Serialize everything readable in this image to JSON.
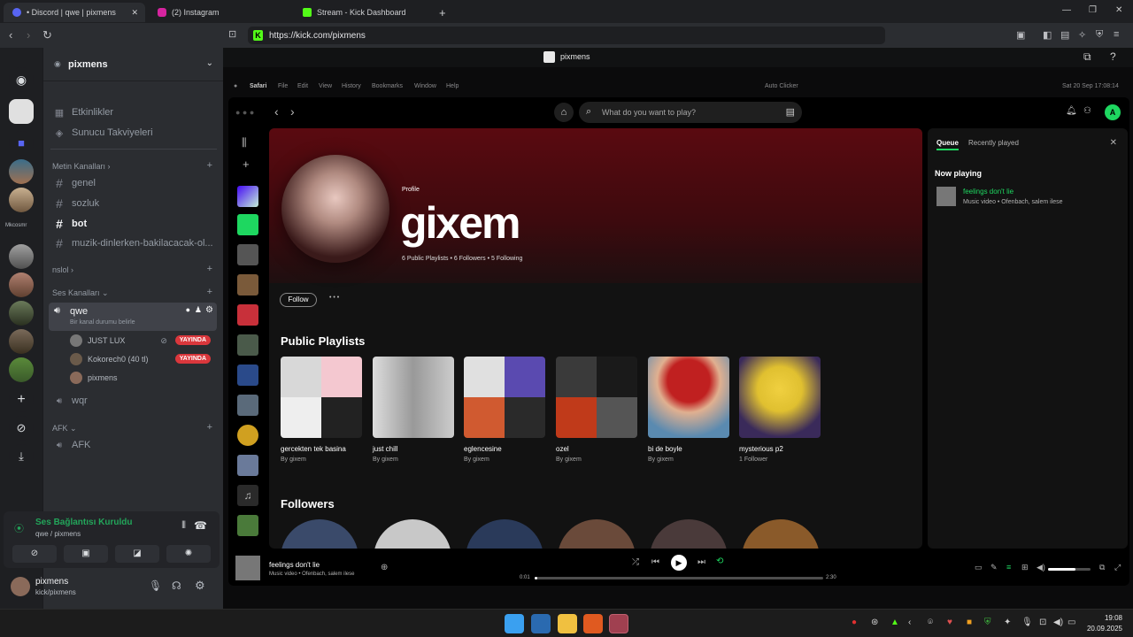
{
  "browser": {
    "tabs": [
      {
        "label": "• Discord | qwe | pixmens",
        "active": true
      },
      {
        "label": "(2) Instagram",
        "active": false
      },
      {
        "label": "Stream - Kick Dashboard",
        "active": false
      }
    ],
    "url": "https://kick.com/pixmens",
    "new_tab": "+",
    "win_min": "—",
    "win_max": "❐",
    "win_close": "✕"
  },
  "discord": {
    "server_name": "pixmens",
    "top_items": [
      "Etkinlikler",
      "Sunucu Takviyeleri"
    ],
    "text_category": "Metin Kanalları",
    "text_channels": [
      "genel",
      "sozluk",
      "bot",
      "muzik-dinlerken-bakilacacak-ol..."
    ],
    "nslol": "nslol",
    "voice_category": "Ses Kanalları",
    "active_voice": "qwe",
    "active_voice_status": "Bir kanal durumu belirle",
    "members": [
      {
        "name": "JUST LUX",
        "live": true
      },
      {
        "name": "Kokorech0 (40 tl)",
        "live": true
      },
      {
        "name": "pixmens",
        "live": false
      }
    ],
    "live_label": "YAYINDA",
    "other_voice": "wqr",
    "afk_category": "AFK",
    "afk_channel": "AFK",
    "server_label_text": "Mkcosmr",
    "voice_status": "Ses Bağlantısı Kuruldu",
    "voice_sub": "qwe / pixmens",
    "user_name": "pixmens",
    "user_sub": "kick/pixmens"
  },
  "kick": {
    "channel_name": "pixmens"
  },
  "mac_menu": [
    "Safari",
    "File",
    "Edit",
    "View",
    "History",
    "Bookmarks",
    "Window",
    "Help"
  ],
  "mac_tray": [
    "Auto Clicker",
    "Sat 20 Sep 17:08:14"
  ],
  "spotify": {
    "search_placeholder": "What do you want to play?",
    "profile_label": "Profile",
    "profile_name": "gixem",
    "profile_stats": "6 Public Playlists • 6 Followers • 5 Following",
    "follow_label": "Follow",
    "more_label": "• • •",
    "public_playlists_title": "Public Playlists",
    "playlists": [
      {
        "name": "gercekten tek basina",
        "by": "By gixem"
      },
      {
        "name": "just chill",
        "by": "By gixem"
      },
      {
        "name": "eglencesine",
        "by": "By gixem"
      },
      {
        "name": "ozel",
        "by": "By gixem"
      },
      {
        "name": "bi de boyle",
        "by": "By gixem"
      },
      {
        "name": "mysterious p2",
        "by": "1 Follower"
      }
    ],
    "followers_title": "Followers",
    "queue_tab": "Queue",
    "recent_tab": "Recently played",
    "now_playing_label": "Now playing",
    "np_title": "feelings don't lie",
    "np_sub": "Music video • Ofenbach, salem ilese",
    "player_title": "feelings don't lie",
    "player_sub": "Music video • Ofenbach, salem ilese",
    "time_current": "0:01",
    "time_total": "2:30",
    "progress": 0.01,
    "volume": 0.65,
    "avatar_letter": "A"
  },
  "taskbar": {
    "time": "19:08",
    "date": "20.09.2025"
  },
  "colors": {
    "spotify_green": "#1ed760",
    "kick_green": "#53fc18",
    "live_red": "#da373c"
  }
}
